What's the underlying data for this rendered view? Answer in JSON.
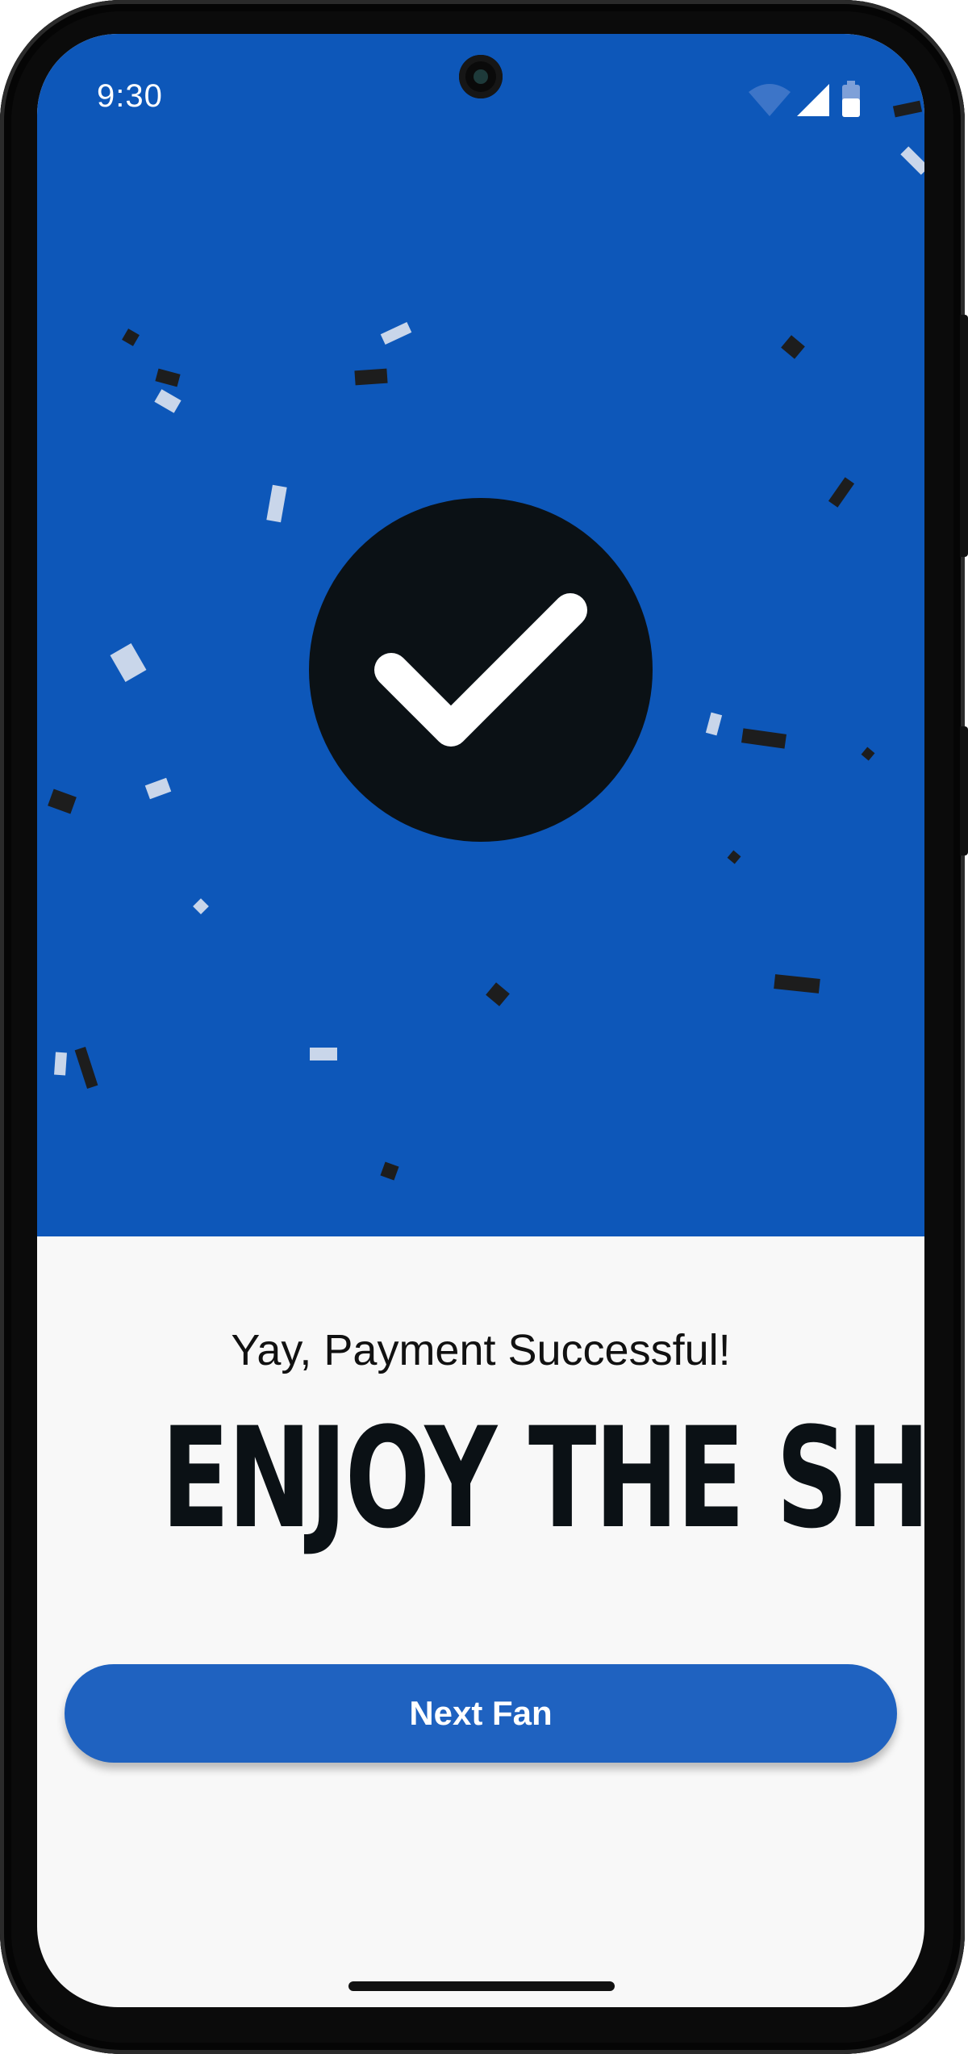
{
  "status_bar": {
    "time": "9:30",
    "icons": [
      "wifi-icon",
      "signal-icon",
      "battery-icon"
    ]
  },
  "hero": {
    "background_color": "#0d57b9",
    "icon": "checkmark-icon",
    "circle_color": "#0b1115"
  },
  "message": {
    "subtitle": "Yay, Payment Successful!",
    "headline": "ENJOY THE SHOW!"
  },
  "actions": {
    "next_button_label": "Next Fan",
    "button_color": "#1f62c0"
  }
}
